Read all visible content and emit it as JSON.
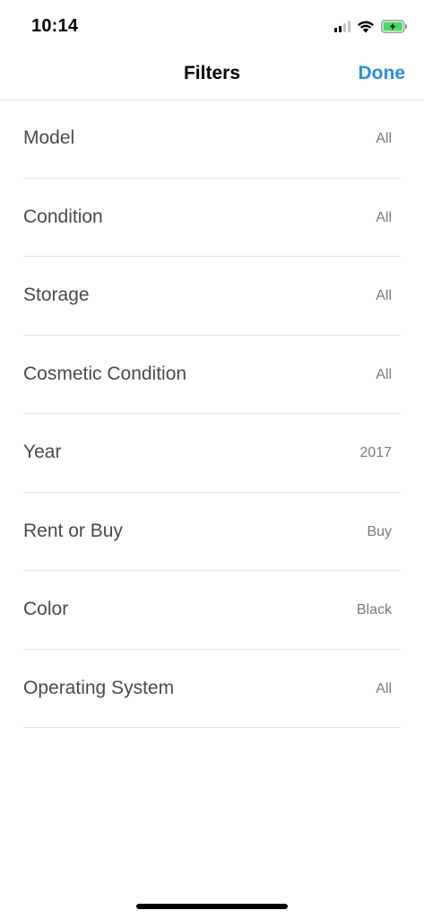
{
  "status_bar": {
    "time": "10:14",
    "icons": [
      "cellular-signal-icon",
      "wifi-icon",
      "battery-charging-icon"
    ],
    "battery_color": "#4cd964"
  },
  "nav": {
    "title": "Filters",
    "done_label": "Done",
    "accent_color": "#2a8fd6"
  },
  "filters": [
    {
      "label": "Model",
      "value": "All"
    },
    {
      "label": "Condition",
      "value": "All"
    },
    {
      "label": "Storage",
      "value": "All"
    },
    {
      "label": "Cosmetic Condition",
      "value": "All"
    },
    {
      "label": "Year",
      "value": "2017"
    },
    {
      "label": "Rent or Buy",
      "value": "Buy"
    },
    {
      "label": "Color",
      "value": "Black"
    },
    {
      "label": "Operating System",
      "value": "All"
    }
  ]
}
